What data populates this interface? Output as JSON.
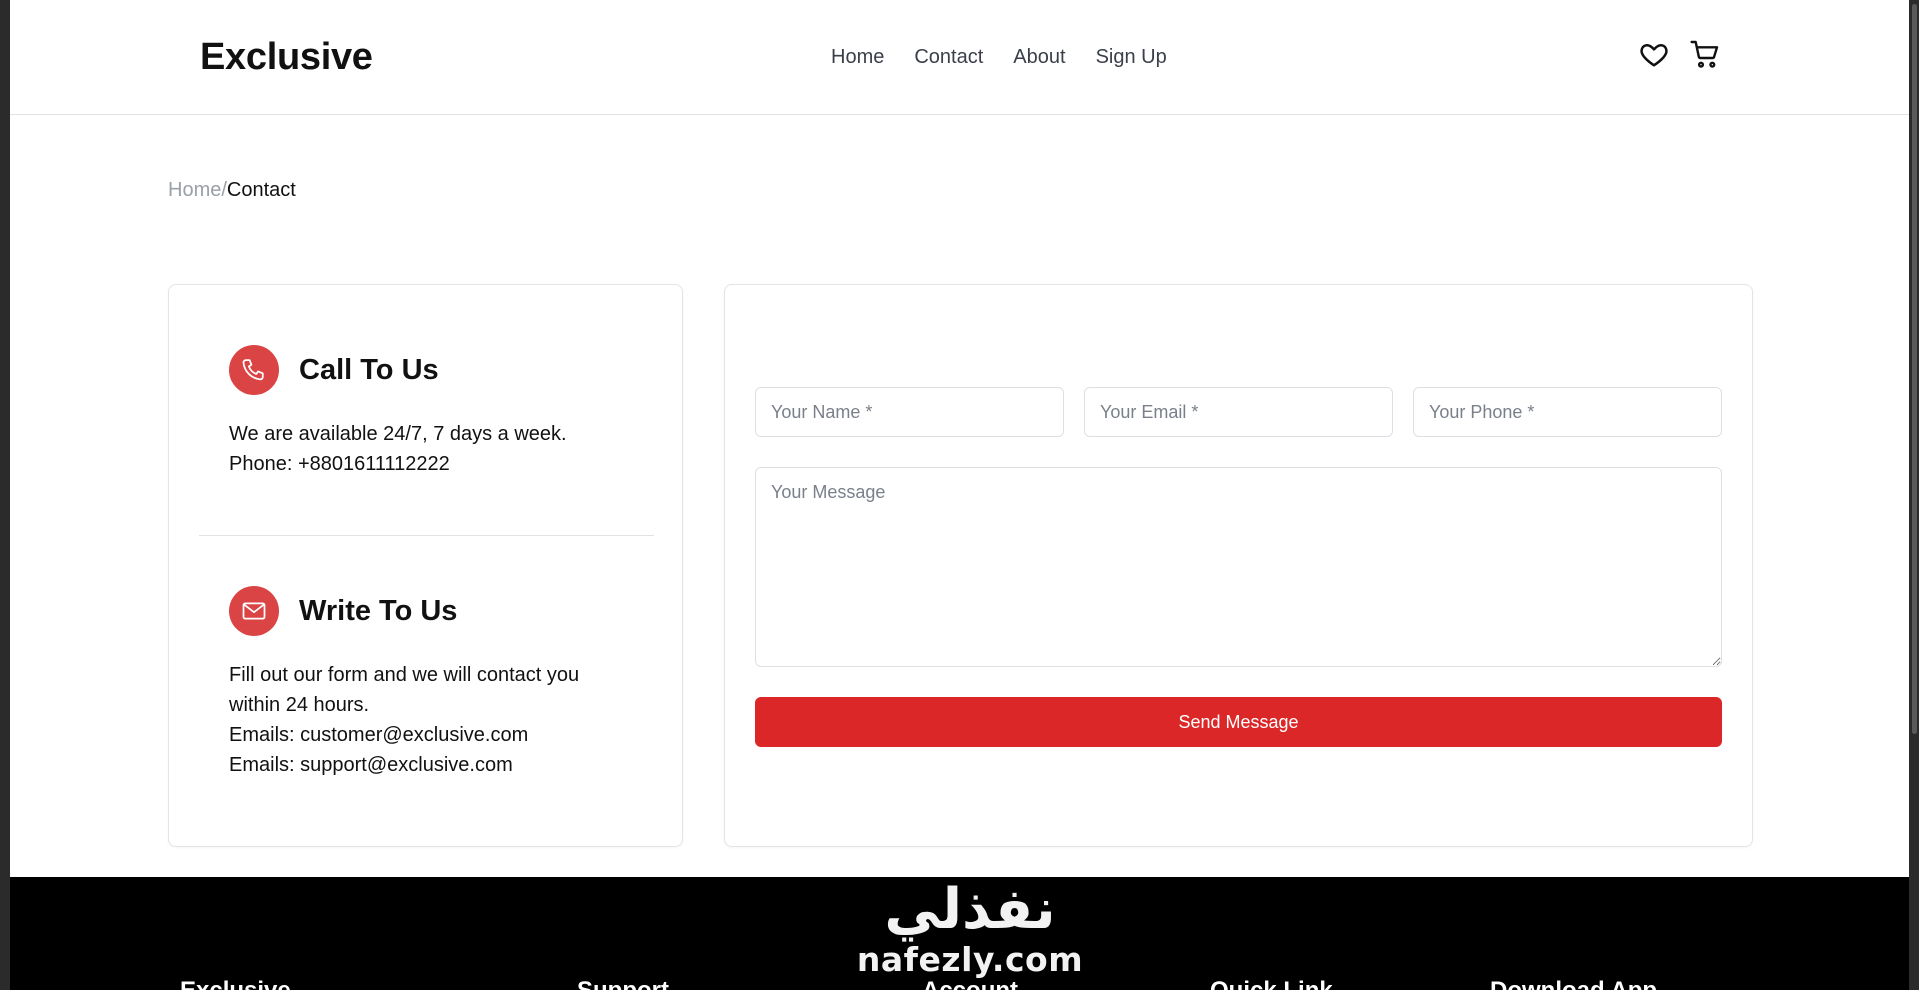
{
  "brand": {
    "logo": "Exclusive",
    "accent_color": "#db4444",
    "button_color": "#db2727"
  },
  "nav": {
    "items": [
      "Home",
      "Contact",
      "About",
      "Sign Up"
    ]
  },
  "header_icons": [
    "heart-icon",
    "cart-icon"
  ],
  "breadcrumb": {
    "home": "Home",
    "separator": "/",
    "current": "Contact"
  },
  "call": {
    "icon": "phone-icon",
    "title": "Call To Us",
    "line1": "We are available 24/7, 7 days a week.",
    "line2": "Phone: +8801611112222"
  },
  "write": {
    "icon": "mail-icon",
    "title": "Write To Us",
    "line1": "Fill out our form and we will contact you",
    "line2": "within 24 hours.",
    "line3": "Emails: customer@exclusive.com",
    "line4": "Emails: support@exclusive.com"
  },
  "form": {
    "name_placeholder": "Your Name *",
    "email_placeholder": "Your Email *",
    "phone_placeholder": "Your Phone *",
    "message_placeholder": "Your Message",
    "submit_label": "Send Message"
  },
  "footer": {
    "columns": [
      "Exclusive",
      "Support",
      "Account",
      "Quick Link",
      "Download App"
    ]
  },
  "watermark": {
    "arabic": "نفذلي",
    "latin": "nafezly.com"
  }
}
